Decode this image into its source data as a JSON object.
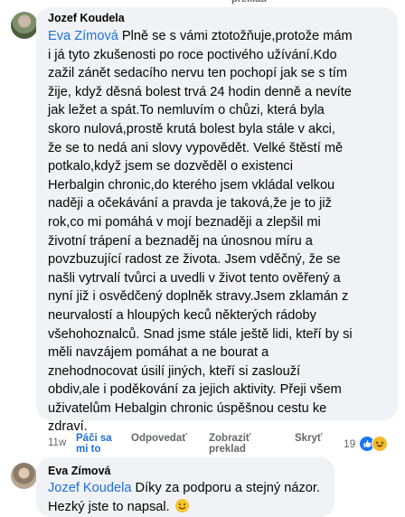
{
  "top_fragment": "preklad",
  "comment": {
    "author": "Jozef Koudela",
    "mention": "Eva Zímová",
    "first_line_rest": " Plně se s vámi ztotožňuje,protože mám",
    "lines": [
      "i já tyto zkušenosti po roce poctivého užívání.Kdo",
      "zažil zánět sedacího nervu ten pochopí jak se s tím",
      "žije, když děsná bolest trvá 24 hodin denně a nevíte",
      "jak ležet a spát.To nemluvím o chůzi, která byla",
      "skoro nulová,prostě krutá bolest byla stále v akci,",
      "že se to nedá ani slovy vypovědět. Velké štěstí mě",
      "potkalo,když jsem se dozvěděl o existenci",
      "Herbalgin chronic,do kterého jsem vkládal velkou",
      "naději a očekávání a pravda je taková,že je to již",
      "rok,co mi pomáhá v mojí beznaději a zlepšil mi",
      "životní trápení a beznaděj na únosnou míru a",
      "povzbuzující radost ze života. Jsem vděčný, že se",
      "našli vytrvalí tvůrci a uvedli v život tento ověřený a",
      "nyní již i osvědčený doplněk stravy.Jsem zklamán z",
      "neurvalostí a hloupých keců některých rádoby",
      "všehohoznalců. Snad jsme stále ještě lidi, kteří by si",
      "měli navzájem pomáhat a ne bourat a",
      "znehodnocovat úsilí jiných, kteří si zaslouží",
      "obdiv,ale i poděkování za jejich aktivity. Přeji všem",
      "uživatelům Hebalgin chronic úspěšnou cestu ke",
      "zdraví."
    ],
    "actions": {
      "time": "11w",
      "like_line1": "Páči sa",
      "like_line2": "mi to",
      "reply": "Odpovedať",
      "translate_line1": "Zobraziť",
      "translate_line2": "preklad",
      "hide": "Skryť"
    },
    "reactions": {
      "count": "19",
      "types": [
        "like-icon",
        "haha-icon"
      ]
    }
  },
  "reply": {
    "author": "Eva Zímová",
    "mention": "Jozef Koudela",
    "first_line_rest": " Díky za podporu a stejný názor.",
    "second_line": "Hezký jste to napsal.",
    "emoji": "smile-emoji-icon"
  }
}
